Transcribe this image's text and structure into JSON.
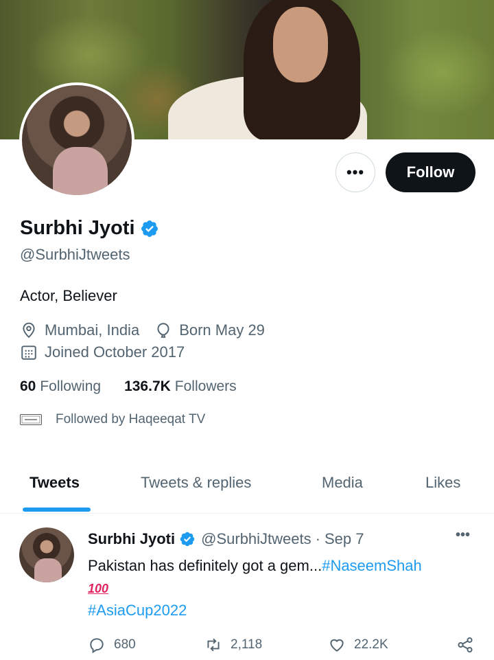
{
  "profile": {
    "name": "Surbhi Jyoti",
    "handle": "@SurbhiJtweets",
    "bio": "Actor, Believer",
    "location": "Mumbai, India",
    "birthday": "Born May 29",
    "joined": "Joined October 2017",
    "following_count": "60",
    "following_label": "Following",
    "followers_count": "136.7K",
    "followers_label": "Followers",
    "followed_by": "Followed by Haqeeqat TV",
    "verified": true
  },
  "buttons": {
    "more_label": "•••",
    "follow_label": "Follow"
  },
  "tabs": [
    {
      "label": "Tweets",
      "active": true
    },
    {
      "label": "Tweets & replies",
      "active": false
    },
    {
      "label": "Media",
      "active": false
    },
    {
      "label": "Likes",
      "active": false
    }
  ],
  "tweet": {
    "name": "Surbhi Jyoti",
    "handle": "@SurbhiJtweets",
    "separator": "·",
    "date": "Sep 7",
    "more": "•••",
    "text_prefix": "Pakistan has definitely got a gem...",
    "hashtag1": "#NaseemShah",
    "emoji": "100",
    "hashtag2": "#AsiaCup2022",
    "replies": "680",
    "retweets": "2,118",
    "likes": "22.2K"
  },
  "colors": {
    "accent": "#1d9bf0",
    "text_primary": "#0f1419",
    "text_secondary": "#536471",
    "follow_button_bg": "#0f1419"
  },
  "icons": {
    "verified": "verified-badge-icon",
    "location": "location-pin-icon",
    "birthday": "balloon-icon",
    "joined": "calendar-icon",
    "reply": "reply-icon",
    "retweet": "retweet-icon",
    "like": "heart-icon",
    "share": "share-icon"
  }
}
